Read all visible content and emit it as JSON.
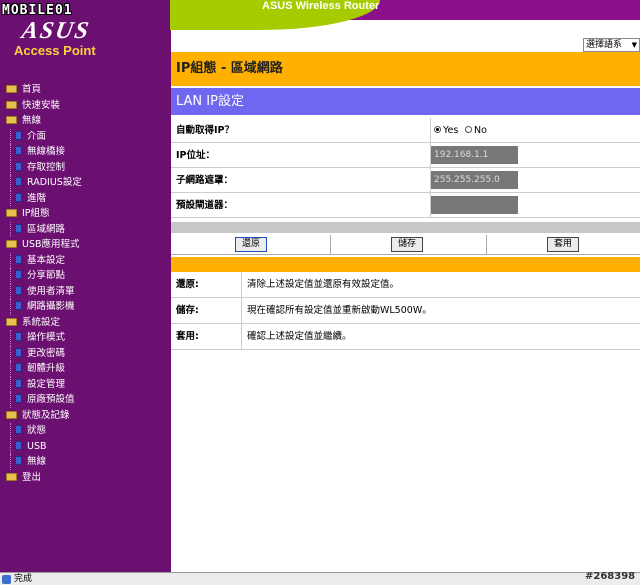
{
  "header": {
    "title": "ASUS Wireless Router",
    "watermark_logo": "MOBILE01",
    "brand": "ASUS",
    "brand_sub": "Access Point",
    "lang_select": "選擇語系"
  },
  "sidebar": {
    "items": [
      {
        "label": "首頁",
        "level": 0,
        "kind": "folder"
      },
      {
        "label": "快速安裝",
        "level": 0,
        "kind": "folder"
      },
      {
        "label": "無線",
        "level": 0,
        "kind": "folder"
      },
      {
        "label": "介面",
        "level": 1,
        "kind": "doc"
      },
      {
        "label": "無線橋接",
        "level": 1,
        "kind": "doc"
      },
      {
        "label": "存取控制",
        "level": 1,
        "kind": "doc"
      },
      {
        "label": "RADIUS設定",
        "level": 1,
        "kind": "doc"
      },
      {
        "label": "進階",
        "level": 1,
        "kind": "doc"
      },
      {
        "label": "IP組態",
        "level": 0,
        "kind": "folder"
      },
      {
        "label": "區域網路",
        "level": 1,
        "kind": "doc"
      },
      {
        "label": "USB應用程式",
        "level": 0,
        "kind": "folder"
      },
      {
        "label": "基本設定",
        "level": 1,
        "kind": "doc"
      },
      {
        "label": "分享節點",
        "level": 1,
        "kind": "doc"
      },
      {
        "label": "使用者清單",
        "level": 1,
        "kind": "doc"
      },
      {
        "label": "網路攝影機",
        "level": 1,
        "kind": "doc"
      },
      {
        "label": "系統設定",
        "level": 0,
        "kind": "folder"
      },
      {
        "label": "操作模式",
        "level": 1,
        "kind": "doc"
      },
      {
        "label": "更改密碼",
        "level": 1,
        "kind": "doc"
      },
      {
        "label": "韌體升級",
        "level": 1,
        "kind": "doc"
      },
      {
        "label": "設定管理",
        "level": 1,
        "kind": "doc"
      },
      {
        "label": "原廠預設值",
        "level": 1,
        "kind": "doc"
      },
      {
        "label": "狀態及記錄",
        "level": 0,
        "kind": "folder"
      },
      {
        "label": "狀態",
        "level": 1,
        "kind": "doc"
      },
      {
        "label": "USB",
        "level": 1,
        "kind": "doc"
      },
      {
        "label": "無線",
        "level": 1,
        "kind": "doc"
      },
      {
        "label": "登出",
        "level": 0,
        "kind": "folder"
      }
    ]
  },
  "main": {
    "page_title": "IP組態 - 區域網路",
    "section_title": "LAN IP設定",
    "form": {
      "auto_ip_label": "自動取得IP？",
      "yes_label": "Yes",
      "no_label": "No",
      "ip_label": "IP位址：",
      "ip_value": "192.168.1.1",
      "subnet_label": "子網路遮罩：",
      "subnet_value": "255.255.255.0",
      "gateway_label": "預設閘道器：",
      "gateway_value": ""
    },
    "buttons": {
      "restore": "還原",
      "save": "儲存",
      "apply": "套用"
    },
    "help": [
      {
        "label": "還原:",
        "text": "清除上述設定值並還原有效設定值。"
      },
      {
        "label": "儲存:",
        "text": "現在確認所有設定值並重新啟動WL500W。"
      },
      {
        "label": "套用:",
        "text": "確認上述設定值並繼續。"
      }
    ]
  },
  "statusbar": {
    "text": "完成",
    "watermark": "#268398"
  },
  "colors": {
    "sidebar": "#6b1070",
    "header_band": "#8c0f8c",
    "header_curve": "#a6cc00",
    "orange": "#ffb000",
    "section": "#7067f0"
  }
}
